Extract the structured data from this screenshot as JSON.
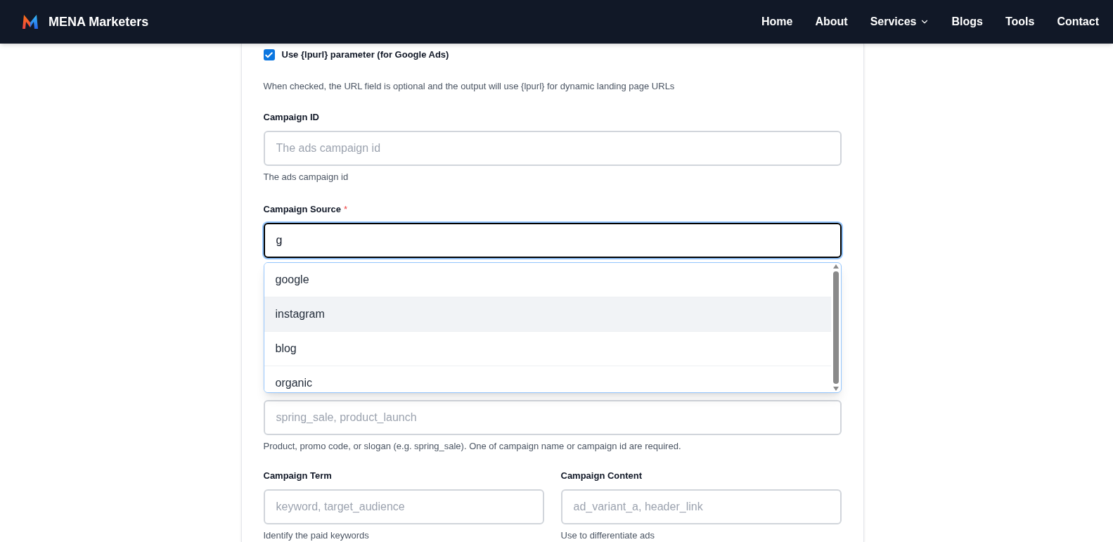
{
  "header": {
    "brand": "MENA Marketers",
    "nav": [
      {
        "label": "Home",
        "dropdown": false
      },
      {
        "label": "About",
        "dropdown": false
      },
      {
        "label": "Services",
        "dropdown": true
      },
      {
        "label": "Blogs",
        "dropdown": false
      },
      {
        "label": "Tools",
        "dropdown": false
      },
      {
        "label": "Contact",
        "dropdown": false
      }
    ]
  },
  "lpurl": {
    "label": "Use {lpurl} parameter (for Google Ads)",
    "checked": true,
    "help": "When checked, the URL field is optional and the output will use {lpurl} for dynamic landing page URLs"
  },
  "campaign_id": {
    "label": "Campaign ID",
    "placeholder": "The ads campaign id",
    "hint": "The ads campaign id"
  },
  "campaign_source": {
    "label": "Campaign Source",
    "required_mark": "*",
    "value": "g",
    "suggestions": [
      {
        "label": "google",
        "selected": false
      },
      {
        "label": "instagram",
        "selected": true
      },
      {
        "label": "blog",
        "selected": false
      },
      {
        "label": "organic",
        "selected": false
      }
    ]
  },
  "campaign_name": {
    "placeholder": "spring_sale, product_launch",
    "hint": "Product, promo code, or slogan (e.g. spring_sale). One of campaign name or campaign id are required."
  },
  "campaign_term": {
    "label": "Campaign Term",
    "placeholder": "keyword, target_audience",
    "hint": "Identify the paid keywords"
  },
  "campaign_content": {
    "label": "Campaign Content",
    "placeholder": "ad_variant_a, header_link",
    "hint": "Use to differentiate ads"
  }
}
